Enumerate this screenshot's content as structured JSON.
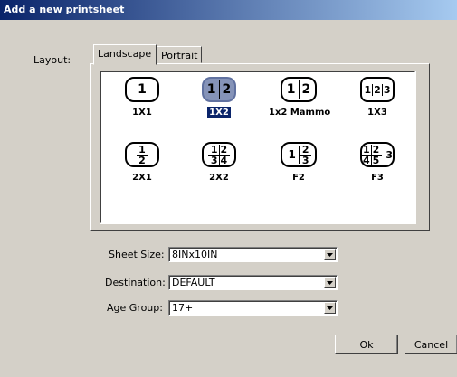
{
  "window": {
    "title": "Add a new printsheet"
  },
  "layout": {
    "label": "Layout:",
    "tabs": [
      {
        "label": "Landscape"
      },
      {
        "label": "Portrait"
      }
    ],
    "items": [
      {
        "name": "1X1",
        "icon_text": "1"
      },
      {
        "name": "1X2",
        "icon_text": "1 2",
        "selected": true
      },
      {
        "name": "1x2 Mammo",
        "icon_text": "1 2"
      },
      {
        "name": "1X3",
        "icon_text": "1 2 3"
      },
      {
        "name": "2X1",
        "icon_text": "1 / 2"
      },
      {
        "name": "2X2",
        "icon_text": "1 2 / 3 4"
      },
      {
        "name": "F2",
        "icon_text": "1 | 2 / 3"
      },
      {
        "name": "F3",
        "icon_text": "1 2 / 4 5 | 3"
      }
    ]
  },
  "form": {
    "sheet_size": {
      "label": "Sheet Size:",
      "value": "8INx10IN"
    },
    "destination": {
      "label": "Destination:",
      "value": "DEFAULT"
    },
    "age_group": {
      "label": "Age Group:",
      "value": "17+"
    }
  },
  "buttons": {
    "ok": "Ok",
    "cancel": "Cancel"
  }
}
